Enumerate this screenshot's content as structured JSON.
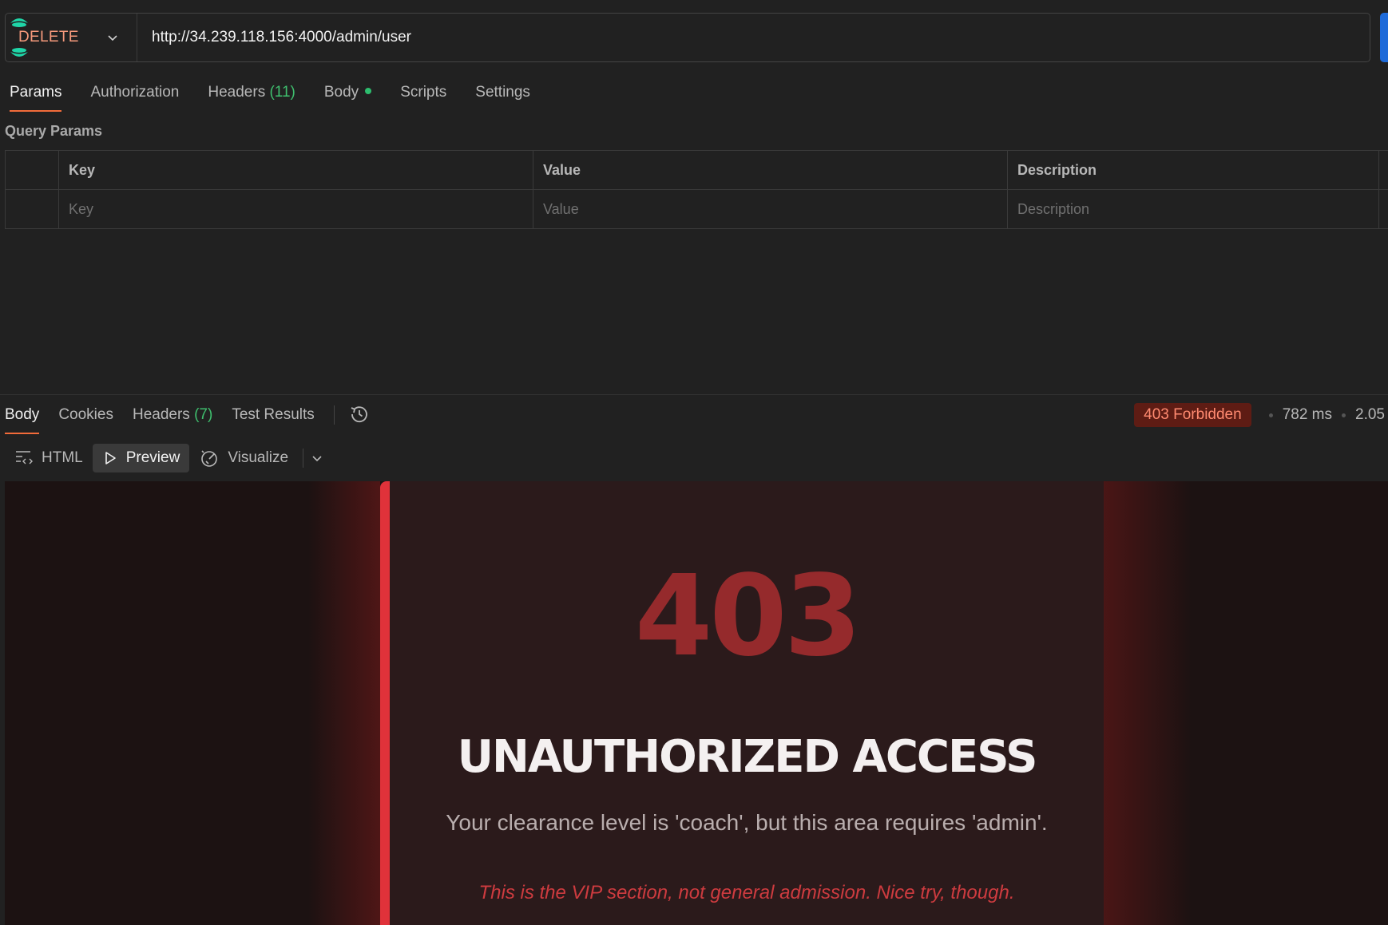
{
  "request": {
    "method": "DELETE",
    "url": "http://34.239.118.156:4000/admin/user"
  },
  "request_tabs": [
    {
      "label": "Params",
      "count": ""
    },
    {
      "label": "Authorization",
      "count": ""
    },
    {
      "label": "Headers",
      "count": "(11)"
    },
    {
      "label": "Body",
      "count": ""
    },
    {
      "label": "Scripts",
      "count": ""
    },
    {
      "label": "Settings",
      "count": ""
    }
  ],
  "query_params": {
    "title": "Query Params",
    "columns": [
      "Key",
      "Value",
      "Description"
    ],
    "placeholders": [
      "Key",
      "Value",
      "Description"
    ]
  },
  "response_tabs": [
    {
      "label": "Body",
      "count": ""
    },
    {
      "label": "Cookies",
      "count": ""
    },
    {
      "label": "Headers",
      "count": "(7)"
    },
    {
      "label": "Test Results",
      "count": ""
    }
  ],
  "response_meta": {
    "status": "403 Forbidden",
    "time": "782 ms",
    "size": "2.05"
  },
  "view_toolbar": {
    "html": "HTML",
    "preview": "Preview",
    "visualize": "Visualize"
  },
  "preview": {
    "code": "403",
    "headline": "UNAUTHORIZED ACCESS",
    "message": "Your clearance level is 'coach', but this area requires 'admin'.",
    "quip": "This is the VIP section, not general admission. Nice try, though."
  },
  "colors": {
    "accent_tab": "#f26b3a",
    "method": "#f79a7c",
    "status_bg": "#5e1c14",
    "status_fg": "#ff8a70",
    "card_stripe": "#e0323a"
  }
}
